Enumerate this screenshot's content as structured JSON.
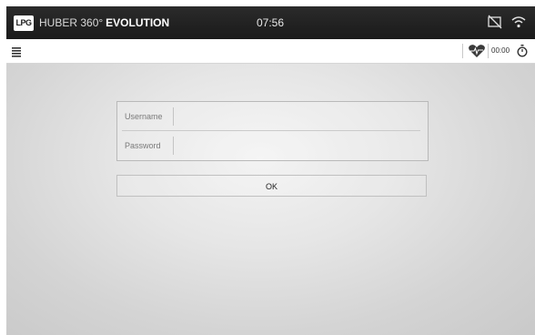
{
  "status_bar": {
    "logo_text": "LPG",
    "brand_light": "HUBER 360°",
    "brand_bold": "EVOLUTION",
    "time": "07:56",
    "icons": [
      "no-screen-cast-icon",
      "wifi-icon"
    ]
  },
  "toolbar": {
    "menu_icon": "menu-icon",
    "heart_icon": "heart-rate-icon",
    "timer": "00:00",
    "stopwatch_icon": "stopwatch-icon"
  },
  "login": {
    "username_label": "Username",
    "username_value": "",
    "password_label": "Password",
    "password_value": "",
    "ok_label": "OK"
  },
  "colors": {
    "status_bar_bg": "#1f1f1f",
    "toolbar_bg": "#ffffff",
    "content_bg": "#dcdcdc"
  }
}
